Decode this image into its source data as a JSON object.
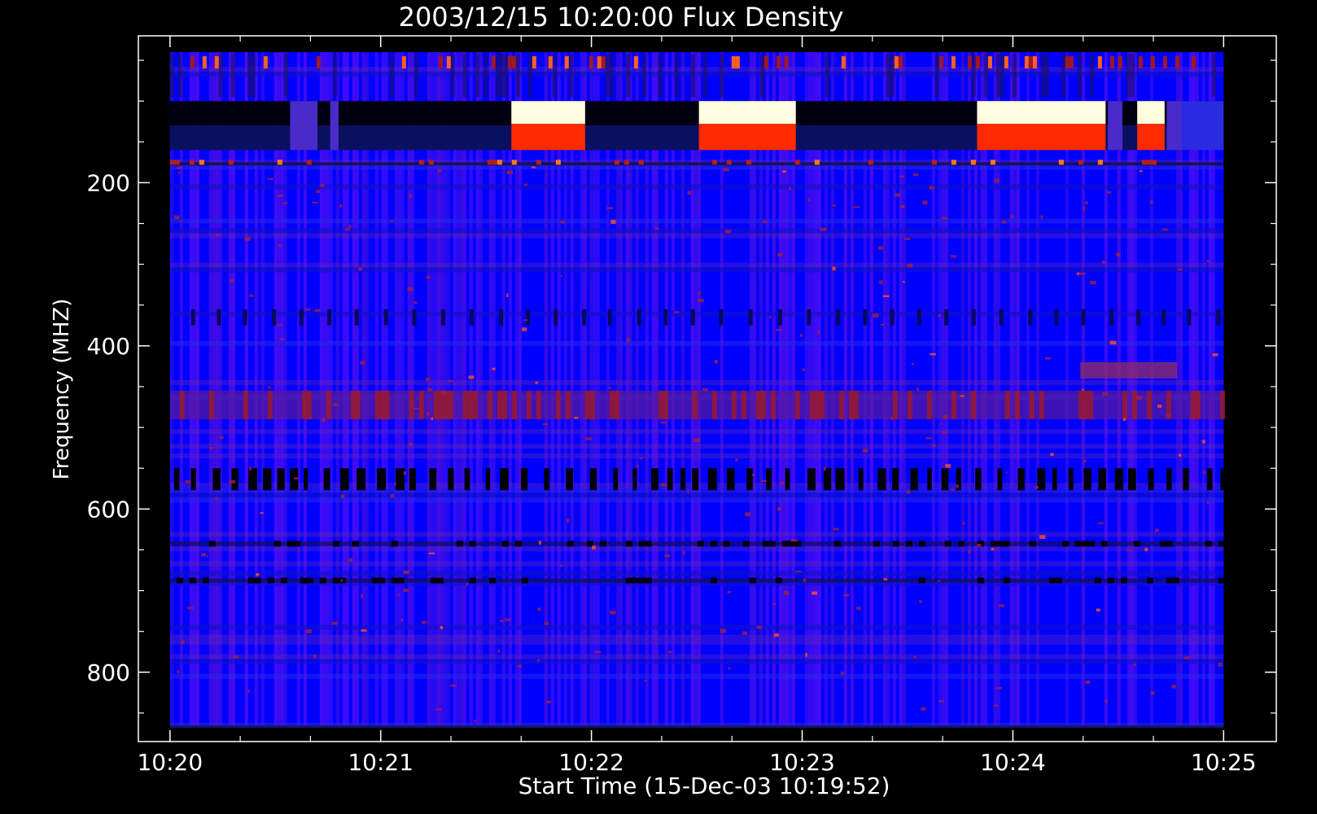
{
  "chart_data": {
    "type": "heatmap",
    "title": "2003/12/15 10:20:00 Flux Density",
    "xlabel": "Start Time (15-Dec-03 10:19:52)",
    "ylabel": "Frequency (MHZ)",
    "x_ticks": [
      "10:20",
      "10:21",
      "10:22",
      "10:23",
      "10:24",
      "10:25"
    ],
    "y_ticks": [
      "200",
      "400",
      "600",
      "800"
    ],
    "xlim_minutes": [
      -0.15,
      5.25
    ],
    "ylim_mhz": [
      20,
      885
    ],
    "data_time_range_minutes": [
      0,
      5
    ],
    "data_freq_range_mhz": [
      40,
      865
    ],
    "colors": {
      "background": "#000000",
      "axes": "#ffffff",
      "low": "#0000ff",
      "mid": "#7a1a8a",
      "high": "#ff2a00",
      "saturated": "#fffde0"
    },
    "saturated_bursts": [
      {
        "t_start": 1.62,
        "t_end": 1.97,
        "f_start": 100,
        "f_end": 160
      },
      {
        "t_start": 2.51,
        "t_end": 2.97,
        "f_start": 100,
        "f_end": 160
      },
      {
        "t_start": 3.83,
        "t_end": 4.44,
        "f_start": 100,
        "f_end": 160
      },
      {
        "t_start": 4.59,
        "t_end": 4.72,
        "f_start": 100,
        "f_end": 160
      }
    ],
    "quiet_band": {
      "f_start": 100,
      "f_end": 160
    },
    "dark_gap_band": {
      "f_start": 550,
      "f_end": 577
    },
    "enhanced_band": {
      "f_start": 455,
      "f_end": 490
    }
  }
}
